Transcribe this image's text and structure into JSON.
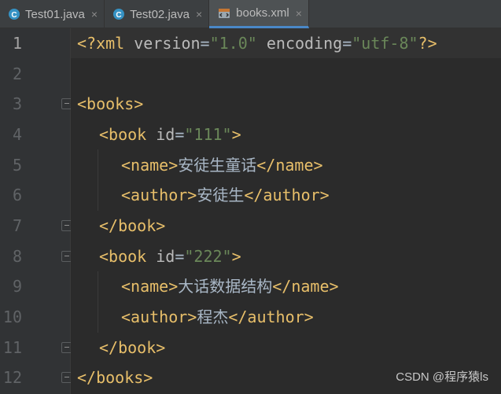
{
  "tabs": [
    {
      "label": "Test01.java",
      "icon": "java-class-icon",
      "close": "×"
    },
    {
      "label": "Test02.java",
      "icon": "java-class-icon",
      "close": "×"
    },
    {
      "label": "books.xml",
      "icon": "xml-file-icon",
      "close": "×"
    }
  ],
  "colors": {
    "tag": "#e8bf6a",
    "attr": "#bababa",
    "value": "#6a8759",
    "text": "#a9b7c6",
    "background": "#2b2b2b",
    "gutter": "#313335",
    "active_tab_underline": "#4a88c7"
  },
  "line_numbers": [
    "1",
    "2",
    "3",
    "4",
    "5",
    "6",
    "7",
    "8",
    "9",
    "10",
    "11",
    "12"
  ],
  "code": {
    "l1": {
      "a": "<?xml ",
      "b": "version",
      "c": "=",
      "d": "\"1.0\"",
      "e": " ",
      "f": "encoding",
      "g": "=",
      "h": "\"utf-8\"",
      "i": "?>"
    },
    "l3": {
      "a": "<books>"
    },
    "l4": {
      "a": "<book ",
      "b": "id",
      "c": "=",
      "d": "\"111\"",
      "e": ">"
    },
    "l5": {
      "a": "<name>",
      "b": "安徒生童话",
      "c": "</name>"
    },
    "l6": {
      "a": "<author>",
      "b": "安徒生",
      "c": "</author>"
    },
    "l7": {
      "a": "</book>"
    },
    "l8": {
      "a": "<book ",
      "b": "id",
      "c": "=",
      "d": "\"222\"",
      "e": ">"
    },
    "l9": {
      "a": "<name>",
      "b": "大话数据结构",
      "c": "</name>"
    },
    "l10": {
      "a": "<author>",
      "b": "程杰",
      "c": "</author>"
    },
    "l11": {
      "a": "</book>"
    },
    "l12": {
      "a": "</books>"
    }
  },
  "watermark": "CSDN @程序猿ls"
}
